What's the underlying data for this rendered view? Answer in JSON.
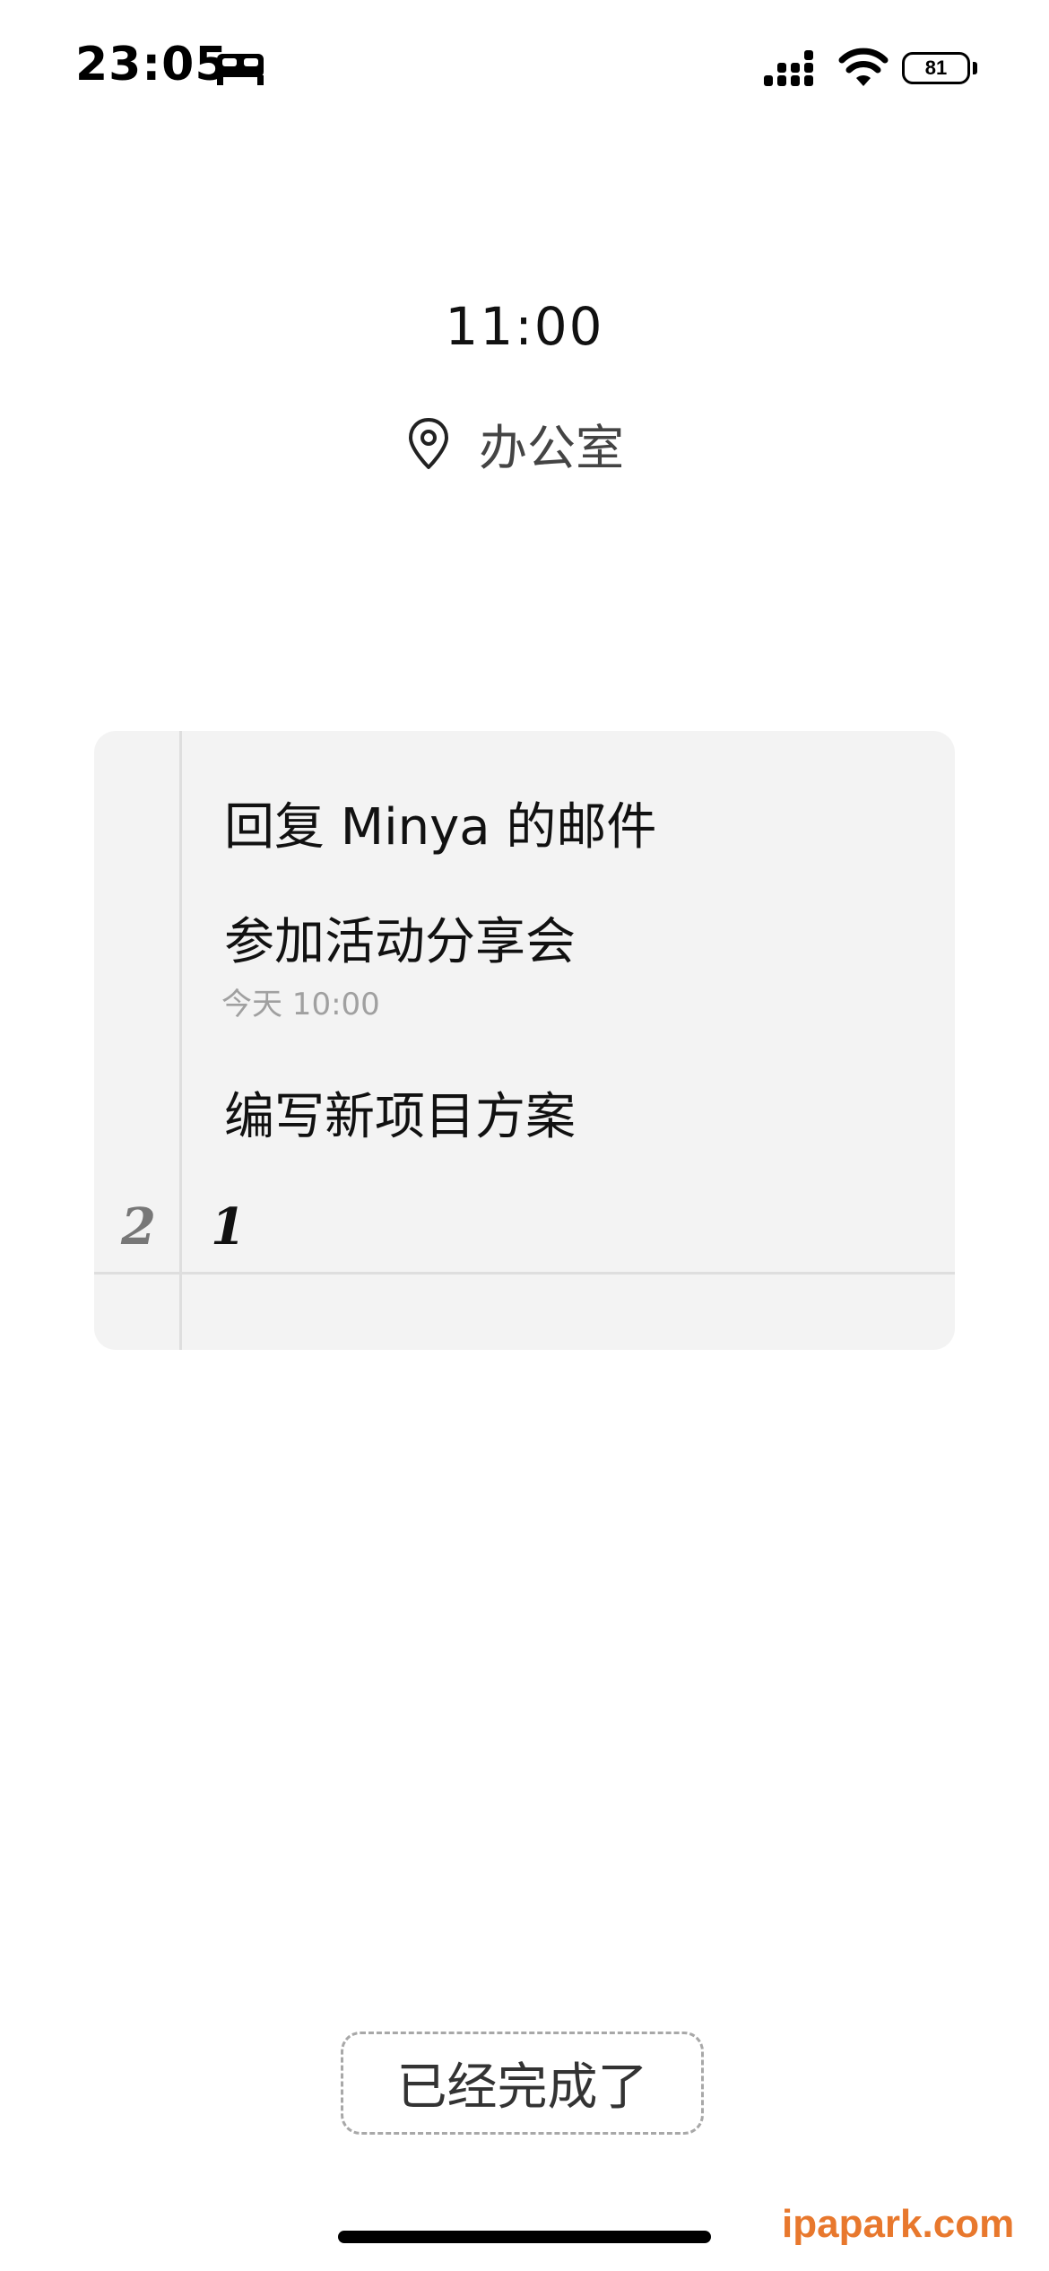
{
  "status_bar": {
    "time": "23:05",
    "battery": "81",
    "icons": [
      "bed-icon",
      "signal-icon",
      "wifi-icon",
      "battery-icon"
    ]
  },
  "header": {
    "time": "11:00",
    "location": "办公室",
    "location_icon": "map-pin-icon"
  },
  "tasks": [
    {
      "title": "回复 Minya 的邮件",
      "subtitle": ""
    },
    {
      "title": "参加活动分享会",
      "subtitle": "今天 10:00"
    },
    {
      "title": "编写新项目方案",
      "subtitle": ""
    }
  ],
  "progress": {
    "total": "2",
    "done": "1"
  },
  "done_button": {
    "label": "已经完成了"
  },
  "watermark": "ipapark.com",
  "colors": {
    "card_background": "#f3f3f3",
    "watermark": "#e8782d",
    "muted_text": "#a0a0a0"
  }
}
